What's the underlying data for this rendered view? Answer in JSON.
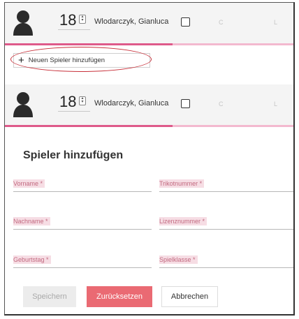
{
  "rows": [
    {
      "jersey_number": "18",
      "player_name": "Wlodarczyk, Gianluca",
      "col_c": "C",
      "col_l": "L"
    },
    {
      "jersey_number": "18",
      "player_name": "Wlodarczyk, Gianluca",
      "col_c": "C",
      "col_l": "L"
    }
  ],
  "add_player_button": {
    "icon": "plus-icon",
    "label": "Neuen Spieler hinzufügen"
  },
  "form": {
    "title": "Spieler hinzufügen",
    "fields": {
      "vorname": "Vorname *",
      "trikotnummer": "Trikotnummer *",
      "nachname": "Nachname *",
      "lizenznummer": "Lizenznummer *",
      "geburtstag": "Geburtstag *",
      "spielklasse": "Spielklasse *"
    },
    "buttons": {
      "save": "Speichern",
      "reset": "Zurücksetzen",
      "cancel": "Abbrechen"
    }
  },
  "colors": {
    "accent_pink": "#de5a8a",
    "reset_button": "#ea6a73",
    "annotation_ellipse": "#c8303a"
  }
}
